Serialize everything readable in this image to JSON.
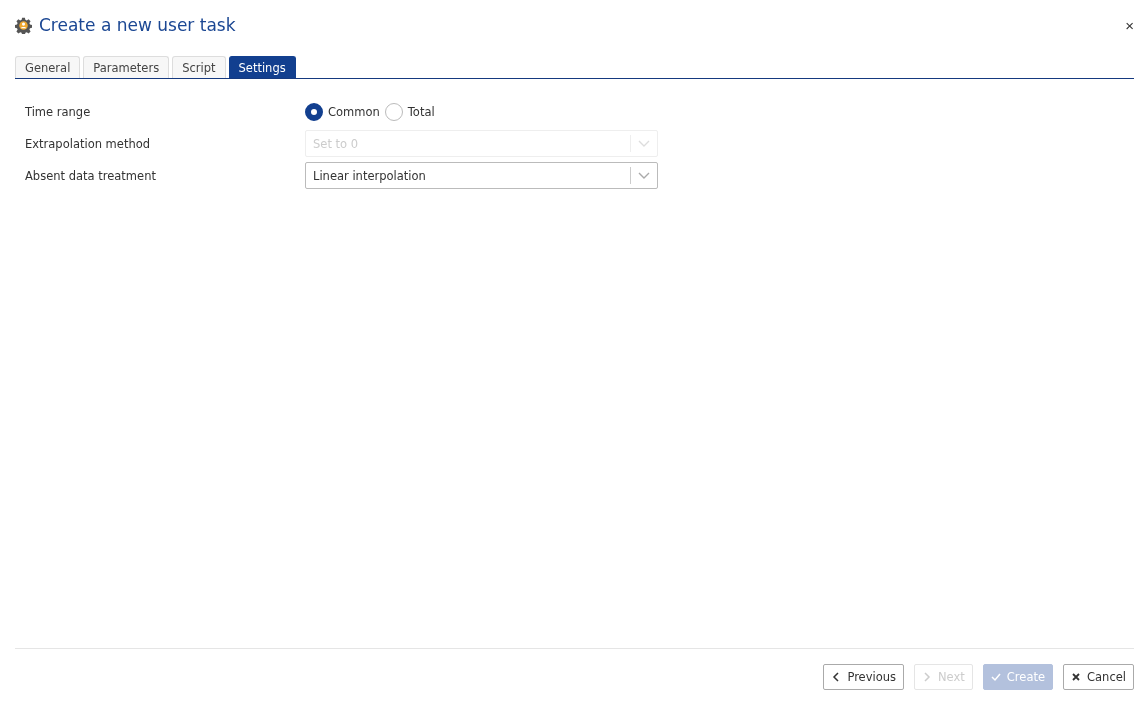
{
  "dialog": {
    "title": "Create a new user task",
    "close": "×"
  },
  "tabs": [
    {
      "label": "General",
      "selected": false
    },
    {
      "label": "Parameters",
      "selected": false
    },
    {
      "label": "Script",
      "selected": false
    },
    {
      "label": "Settings",
      "selected": true
    }
  ],
  "settings": [
    {
      "kind": "radio",
      "label": "Time range",
      "options": [
        {
          "label": "Common",
          "selected": true
        },
        {
          "label": "Total",
          "selected": false
        }
      ]
    },
    {
      "kind": "select",
      "label": "Extrapolation method",
      "value": "Set to 0",
      "disabled": true
    },
    {
      "kind": "select",
      "label": "Absent data treatment",
      "value": "Linear interpolation",
      "disabled": false
    }
  ],
  "buttons": [
    {
      "label": "Previous",
      "kind": "prev",
      "disabled": false,
      "primary": false
    },
    {
      "label": "Next",
      "kind": "next",
      "disabled": true,
      "primary": false
    },
    {
      "label": "Create",
      "kind": "check",
      "disabled": true,
      "primary": true
    },
    {
      "label": "Cancel",
      "kind": "cross",
      "disabled": false,
      "primary": false
    }
  ]
}
